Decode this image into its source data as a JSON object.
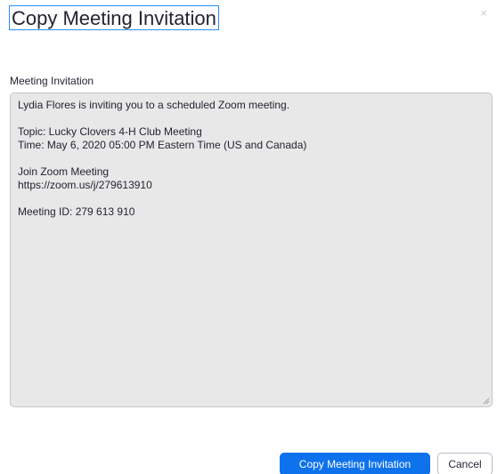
{
  "dialog": {
    "title": "Copy Meeting Invitation",
    "close_icon": "close-icon",
    "close_glyph": "×"
  },
  "invitation": {
    "label": "Meeting Invitation",
    "lines": [
      "Lydia Flores is inviting you to a scheduled Zoom meeting.",
      "",
      "Topic: Lucky Clovers 4-H Club Meeting",
      "Time: May 6, 2020 05:00 PM Eastern Time (US and Canada)",
      "",
      "Join Zoom Meeting",
      "https://zoom.us/j/279613910",
      "",
      "Meeting ID: 279 613 910"
    ]
  },
  "buttons": {
    "copy_label": "Copy Meeting Invitation",
    "cancel_label": "Cancel"
  },
  "colors": {
    "accent": "#0e72ed",
    "focus_border": "#2d8cff",
    "textarea_bg": "#e8e8e8"
  }
}
